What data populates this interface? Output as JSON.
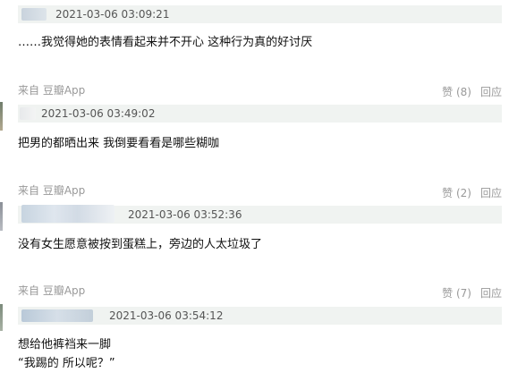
{
  "comments": [
    {
      "timestamp": "2021-03-06 03:09:21",
      "lines": [
        "……我觉得她的表情看起来并不开心 这种行为真的好讨厌"
      ],
      "source": "来自 豆瓣App",
      "like_label": "赞 (8)",
      "reply_label": "回应"
    },
    {
      "timestamp": "2021-03-06 03:49:02",
      "lines": [
        "把男的都晒出来 我倒要看看是哪些糊咖"
      ],
      "source": "来自 豆瓣App",
      "like_label": "赞 (2)",
      "reply_label": "回应"
    },
    {
      "timestamp": "2021-03-06 03:52:36",
      "lines": [
        "没有女生愿意被按到蛋糕上，旁边的人太垃圾了"
      ],
      "source": "来自 豆瓣App",
      "like_label": "赞 (7)",
      "reply_label": "回应"
    },
    {
      "timestamp": "2021-03-06 03:54:12",
      "lines": [
        "想给他裤裆来一脚",
        "“我踢的 所以呢？”"
      ]
    }
  ]
}
